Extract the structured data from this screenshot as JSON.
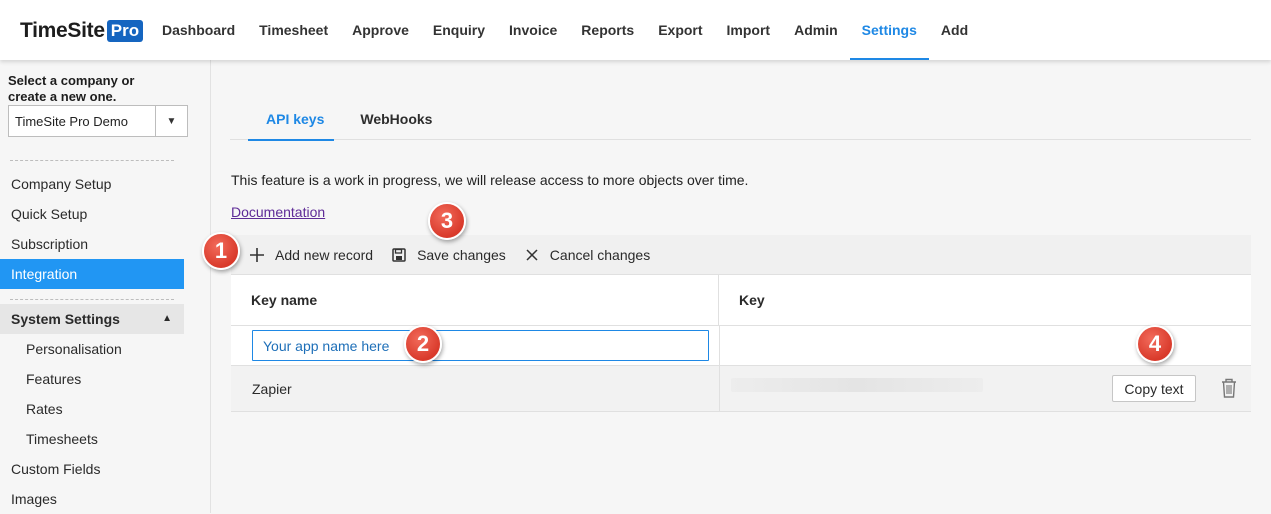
{
  "brand": {
    "name": "TimeSite",
    "badge": "Pro"
  },
  "nav": [
    "Dashboard",
    "Timesheet",
    "Approve",
    "Enquiry",
    "Invoice",
    "Reports",
    "Export",
    "Import",
    "Admin",
    "Settings",
    "Add"
  ],
  "nav_active": "Settings",
  "sidebar": {
    "company_prompt": "Select a company or create a new one.",
    "company_value": "TimeSite Pro Demo",
    "items": [
      "Company Setup",
      "Quick Setup",
      "Subscription",
      "Integration"
    ],
    "active_item": "Integration",
    "group": "System Settings",
    "group_items": [
      "Personalisation",
      "Features",
      "Rates",
      "Timesheets"
    ],
    "more_items": [
      "Custom Fields",
      "Images"
    ]
  },
  "tabs": [
    "API keys",
    "WebHooks"
  ],
  "tab_active": "API keys",
  "notice": "This feature is a work in progress, we will release access to more objects over time.",
  "documentation_link": "Documentation",
  "toolbar": {
    "add": "Add new record",
    "save": "Save changes",
    "cancel": "Cancel changes"
  },
  "grid": {
    "columns": [
      "Key name",
      "Key"
    ],
    "edit_value": "Your app name here",
    "rows": [
      {
        "name": "Zapier",
        "copy_label": "Copy text"
      }
    ]
  },
  "callouts": [
    "1",
    "2",
    "3",
    "4"
  ],
  "colors": {
    "accent": "#1e88e5",
    "callout": "#d93a2b",
    "active_sidebar": "#2196f3"
  }
}
